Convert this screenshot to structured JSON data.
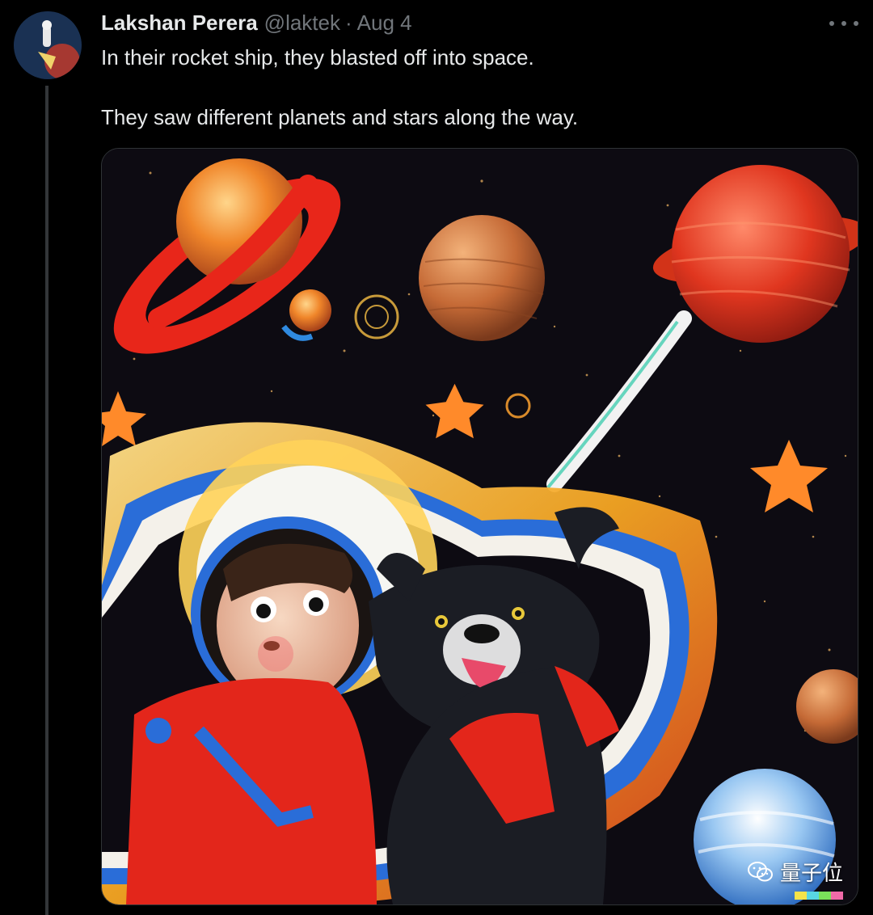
{
  "tweet": {
    "author": {
      "display_name": "Lakshan Perera",
      "handle": "@laktek"
    },
    "separator": "·",
    "date": "Aug 4",
    "text_lines": [
      "In their rocket ship, they blasted off into space.",
      "They saw different planets and stars along the way."
    ]
  },
  "icons": {
    "more": "more-horizontal-icon",
    "watermark_logo": "wechat-icon"
  },
  "watermark": {
    "text": "量子位"
  },
  "colors": {
    "background": "#000000",
    "primary_text": "#e7e9ea",
    "secondary_text": "#71767b",
    "thread_line": "#333639"
  }
}
